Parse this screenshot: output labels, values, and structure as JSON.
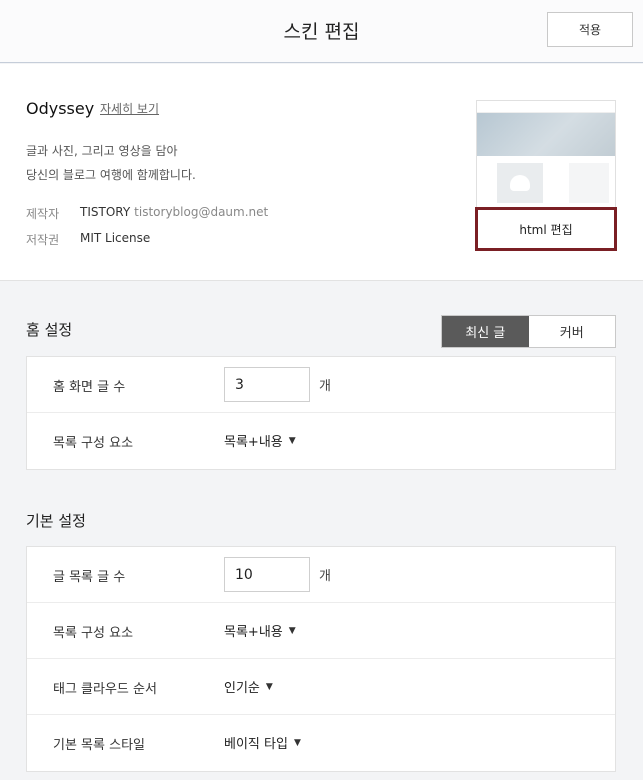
{
  "header": {
    "title": "스킨 편집",
    "apply_label": "적용"
  },
  "skin": {
    "name": "Odyssey",
    "detail_link": "자세히 보기",
    "description_line1": "글과 사진, 그리고 영상을 담아",
    "description_line2": "당신의 블로그 여행에 함께합니다.",
    "maker_label": "제작자",
    "maker_name": "TISTORY",
    "maker_email": "tistoryblog@daum.net",
    "license_label": "저작권",
    "license_value": "MIT License",
    "html_edit_label": "html 편집"
  },
  "home": {
    "title": "홈 설정",
    "toggle": [
      {
        "label": "최신 글",
        "active": true
      },
      {
        "label": "커버",
        "active": false
      }
    ],
    "rows": {
      "post_count_label": "홈 화면 글 수",
      "post_count_value": "3",
      "post_count_unit": "개",
      "list_component_label": "목록 구성 요소",
      "list_component_value": "목록+내용"
    }
  },
  "basic": {
    "title": "기본 설정",
    "rows": {
      "list_count_label": "글 목록 글 수",
      "list_count_value": "10",
      "list_count_unit": "개",
      "list_component_label": "목록 구성 요소",
      "list_component_value": "목록+내용",
      "tag_order_label": "태그 클라우드 순서",
      "tag_order_value": "인기순",
      "list_style_label": "기본 목록 스타일",
      "list_style_value": "베이직 타입"
    }
  },
  "icons": {
    "dropdown": "caret-down-icon"
  }
}
